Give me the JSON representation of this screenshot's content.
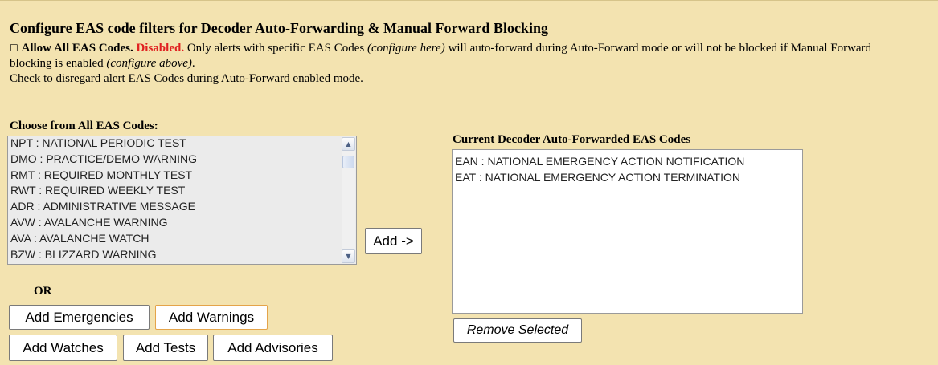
{
  "header": {
    "title": "Configure EAS code filters for Decoder Auto-Forwarding & Manual Forward Blocking"
  },
  "description": {
    "checkbox_glyph": "☐",
    "allow_label": "Allow All EAS Codes.",
    "status": "Disabled.",
    "text1": " Only alerts with specific EAS Codes ",
    "italic1": "(configure here)",
    "text2": " will auto-forward during Auto-Forward mode or will not be blocked if Manual Forward blocking is enabled ",
    "italic2": "(configure above)",
    "text3": ".",
    "line3": "Check to disregard alert EAS Codes during Auto-Forward enabled mode."
  },
  "all_codes": {
    "label": "Choose from All EAS Codes:",
    "items": [
      "NPT : NATIONAL PERIODIC TEST",
      "DMO : PRACTICE/DEMO WARNING",
      "RMT : REQUIRED MONTHLY TEST",
      "RWT : REQUIRED WEEKLY TEST",
      "ADR : ADMINISTRATIVE MESSAGE",
      "AVW : AVALANCHE WARNING",
      "AVA : AVALANCHE WATCH",
      "BZW : BLIZZARD WARNING"
    ]
  },
  "forwarded_codes": {
    "label": "Current Decoder Auto-Forwarded EAS Codes",
    "items": [
      "EAN : NATIONAL EMERGENCY ACTION NOTIFICATION",
      "EAT : NATIONAL EMERGENCY ACTION TERMINATION"
    ]
  },
  "buttons": {
    "add": "Add ->",
    "remove": "Remove Selected",
    "or": "OR",
    "emergencies": "Add Emergencies",
    "warnings": "Add Warnings",
    "watches": "Add Watches",
    "tests": "Add Tests",
    "advisories": "Add Advisories"
  },
  "icons": {
    "scroll_up": "scroll-up-arrow-icon",
    "scroll_down": "scroll-down-arrow-icon"
  },
  "colors": {
    "background": "#f3e3b0",
    "status_disabled": "#e02020"
  }
}
